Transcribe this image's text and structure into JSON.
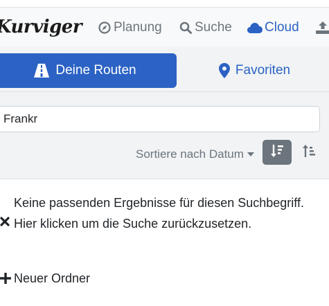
{
  "app": {
    "logo_text": "Kurviger"
  },
  "nav": {
    "planning": "Planung",
    "search": "Suche",
    "cloud": "Cloud"
  },
  "tabs": {
    "routes": "Deine Routen",
    "favorites": "Favoriten"
  },
  "filter": {
    "search_value": "Frankr",
    "sort_label": "Sortiere nach Datum"
  },
  "results": {
    "empty_message": "Keine passenden Ergebnisse für diesen Suchbegriff. Hier klicken um die Suche zurückzusetzen."
  },
  "actions": {
    "new_folder": "Neuer Ordner"
  },
  "colors": {
    "accent": "#2b62c4",
    "muted": "#6c757d",
    "panel": "#f1f3f5"
  }
}
